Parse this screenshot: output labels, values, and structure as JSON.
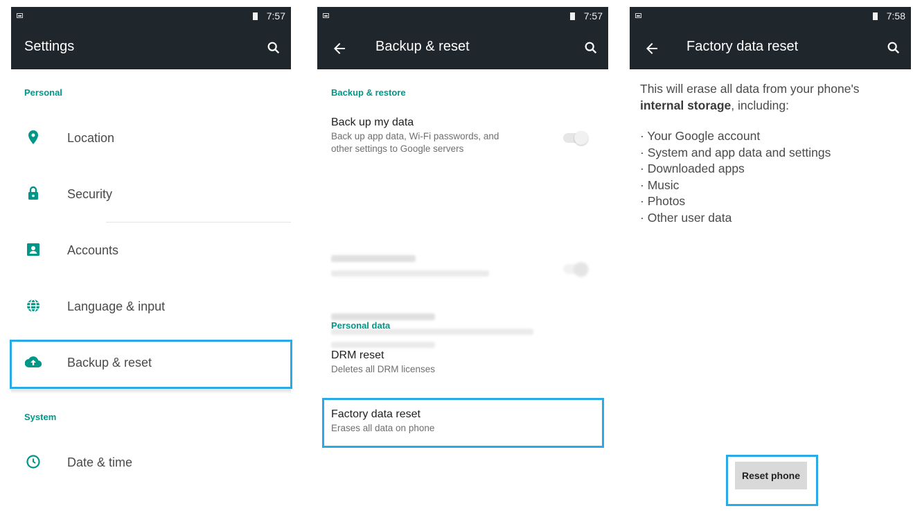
{
  "colors": {
    "toolbar_bg": "#1f262c",
    "accent": "#009688",
    "highlight": "#29a9e6"
  },
  "screen1": {
    "status_time": "7:57",
    "title": "Settings",
    "section_personal": "Personal",
    "items": [
      {
        "label": "Location",
        "icon": "location-pin-icon"
      },
      {
        "label": "Security",
        "icon": "lock-icon"
      },
      {
        "label": "Accounts",
        "icon": "account-box-icon"
      },
      {
        "label": "Language & input",
        "icon": "globe-icon"
      },
      {
        "label": "Backup & reset",
        "icon": "cloud-upload-icon"
      }
    ],
    "section_system": "System",
    "system_items": [
      {
        "label": "Date & time",
        "icon": "clock-icon"
      }
    ]
  },
  "screen2": {
    "status_time": "7:57",
    "title": "Backup & reset",
    "section_backup": "Backup & restore",
    "backup_data_title": "Back up my data",
    "backup_data_summary_line1": "Back up app data, Wi-Fi passwords, and",
    "backup_data_summary_line2": "other settings to Google servers",
    "backup_data_toggle_on": false,
    "section_personal": "Personal data",
    "drm_title": "DRM reset",
    "drm_summary": "Deletes all DRM licenses",
    "fdr_title": "Factory data reset",
    "fdr_summary": "Erases all data on phone"
  },
  "screen3": {
    "status_time": "7:58",
    "title": "Factory data reset",
    "intro_line1": "This will erase all data from your phone's",
    "intro_bold": "internal storage",
    "intro_rest": ", including:",
    "list": [
      "Your Google account",
      "System and app data and settings",
      "Downloaded apps",
      "Music",
      "Photos",
      "Other user data"
    ],
    "reset_button": "Reset phone"
  }
}
